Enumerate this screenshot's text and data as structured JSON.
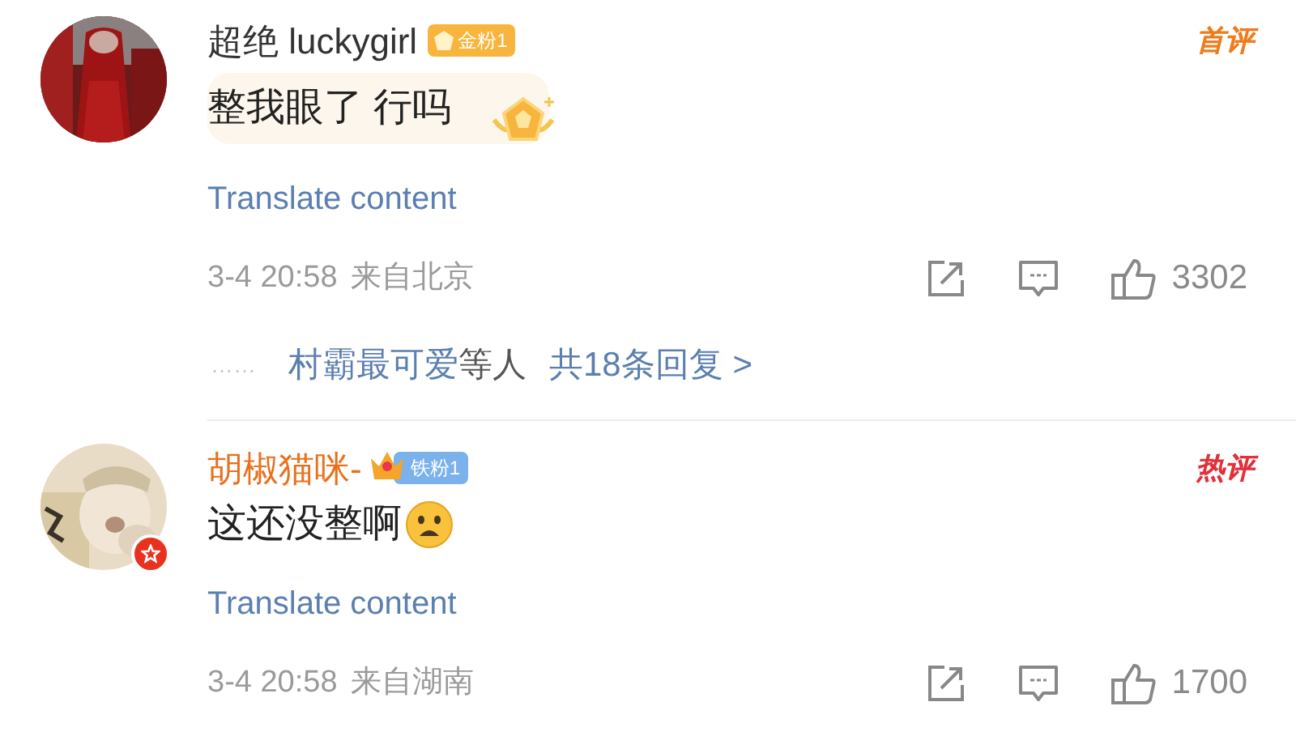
{
  "comments": [
    {
      "username": "超绝 luckygirl",
      "color": "#333333",
      "badge": {
        "kind": "gold",
        "label": "金粉1"
      },
      "verified": false,
      "tag": {
        "kind": "first",
        "label": "首评"
      },
      "text": "整我眼了 行吗",
      "bubble": true,
      "sticker": true,
      "emoji": false,
      "translate": "Translate content",
      "time": "3-4 20:58",
      "location": "来自北京",
      "likes": "3302",
      "replies": {
        "dots": "……",
        "names": "村霸最可爱",
        "suffix": "等人",
        "count": "共18条回复 >"
      }
    },
    {
      "username": "胡椒猫咪-",
      "color": "#e8711e",
      "badge": {
        "kind": "iron",
        "label": "铁粉1"
      },
      "verified": true,
      "tag": {
        "kind": "hot",
        "label": "热评"
      },
      "text": "这还没整啊",
      "bubble": false,
      "sticker": false,
      "emoji": true,
      "translate": "Translate content",
      "time": "3-4 20:58",
      "location": "来自湖南",
      "likes": "1700"
    }
  ]
}
